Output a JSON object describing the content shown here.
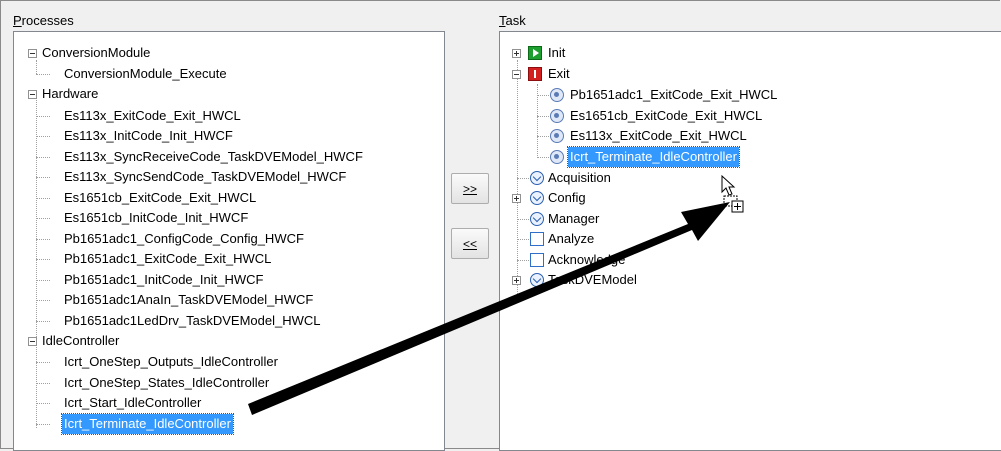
{
  "processes": {
    "label_prefix": "P",
    "label_rest": "rocesses",
    "items": [
      {
        "label": "ConversionModule"
      },
      {
        "label": "ConversionModule_Execute"
      },
      {
        "label": "Hardware"
      },
      {
        "label": "Es113x_ExitCode_Exit_HWCL"
      },
      {
        "label": "Es113x_InitCode_Init_HWCF"
      },
      {
        "label": "Es113x_SyncReceiveCode_TaskDVEModel_HWCF"
      },
      {
        "label": "Es113x_SyncSendCode_TaskDVEModel_HWCF"
      },
      {
        "label": "Es1651cb_ExitCode_Exit_HWCL"
      },
      {
        "label": "Es1651cb_InitCode_Init_HWCF"
      },
      {
        "label": "Pb1651adc1_ConfigCode_Config_HWCF"
      },
      {
        "label": "Pb1651adc1_ExitCode_Exit_HWCL"
      },
      {
        "label": "Pb1651adc1_InitCode_Init_HWCF"
      },
      {
        "label": "Pb1651adc1AnaIn_TaskDVEModel_HWCF"
      },
      {
        "label": "Pb1651adc1LedDrv_TaskDVEModel_HWCL"
      },
      {
        "label": "IdleController"
      },
      {
        "label": "Icrt_OneStep_Outputs_IdleController"
      },
      {
        "label": "Icrt_OneStep_States_IdleController"
      },
      {
        "label": "Icrt_Start_IdleController"
      },
      {
        "label": "Icrt_Terminate_IdleController"
      }
    ]
  },
  "task": {
    "label_prefix": "T",
    "label_rest": "ask",
    "items": [
      {
        "label": "Init",
        "icon": "green-play-icon"
      },
      {
        "label": "Exit",
        "icon": "red-pause-icon"
      },
      {
        "label": "Pb1651adc1_ExitCode_Exit_HWCL",
        "icon": "process-gear-icon"
      },
      {
        "label": "Es1651cb_ExitCode_Exit_HWCL",
        "icon": "process-gear-icon"
      },
      {
        "label": "Es113x_ExitCode_Exit_HWCL",
        "icon": "process-gear-icon"
      },
      {
        "label": "Icrt_Terminate_IdleController",
        "icon": "process-gear-icon"
      },
      {
        "label": "Acquisition",
        "icon": "clock-icon"
      },
      {
        "label": "Config",
        "icon": "clock-icon"
      },
      {
        "label": "Manager",
        "icon": "clock-icon"
      },
      {
        "label": "Analyze",
        "icon": "square-icon"
      },
      {
        "label": "Acknowledge",
        "icon": "square-icon"
      },
      {
        "label": "TaskDVEModel",
        "icon": "clock-icon"
      }
    ]
  },
  "buttons": {
    "add_label": ">>",
    "remove_label": "<<"
  },
  "colors": {
    "selection": "#3399ff",
    "arrow": "#000000"
  }
}
